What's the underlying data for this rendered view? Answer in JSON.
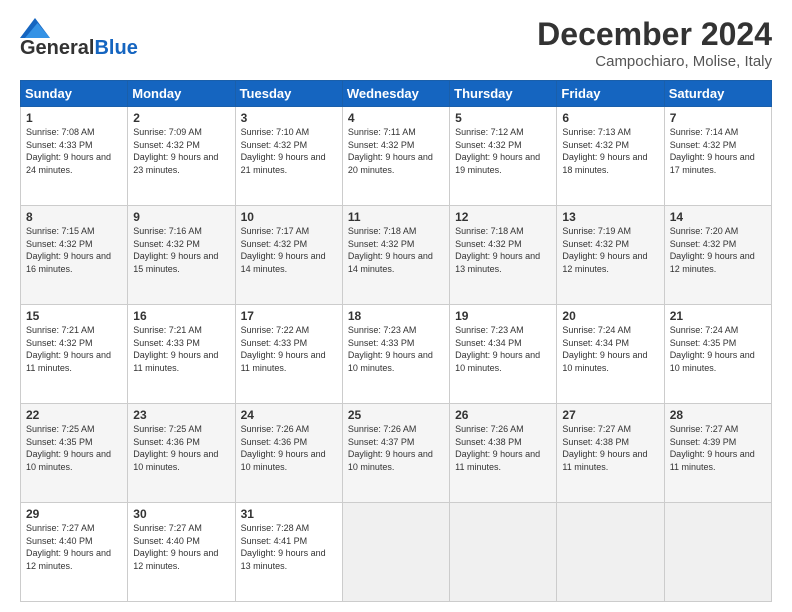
{
  "logo": {
    "general": "General",
    "blue": "Blue"
  },
  "title": "December 2024",
  "location": "Campochiaro, Molise, Italy",
  "days_of_week": [
    "Sunday",
    "Monday",
    "Tuesday",
    "Wednesday",
    "Thursday",
    "Friday",
    "Saturday"
  ],
  "weeks": [
    [
      {
        "day": "1",
        "sunrise": "Sunrise: 7:08 AM",
        "sunset": "Sunset: 4:33 PM",
        "daylight": "Daylight: 9 hours and 24 minutes."
      },
      {
        "day": "2",
        "sunrise": "Sunrise: 7:09 AM",
        "sunset": "Sunset: 4:32 PM",
        "daylight": "Daylight: 9 hours and 23 minutes."
      },
      {
        "day": "3",
        "sunrise": "Sunrise: 7:10 AM",
        "sunset": "Sunset: 4:32 PM",
        "daylight": "Daylight: 9 hours and 21 minutes."
      },
      {
        "day": "4",
        "sunrise": "Sunrise: 7:11 AM",
        "sunset": "Sunset: 4:32 PM",
        "daylight": "Daylight: 9 hours and 20 minutes."
      },
      {
        "day": "5",
        "sunrise": "Sunrise: 7:12 AM",
        "sunset": "Sunset: 4:32 PM",
        "daylight": "Daylight: 9 hours and 19 minutes."
      },
      {
        "day": "6",
        "sunrise": "Sunrise: 7:13 AM",
        "sunset": "Sunset: 4:32 PM",
        "daylight": "Daylight: 9 hours and 18 minutes."
      },
      {
        "day": "7",
        "sunrise": "Sunrise: 7:14 AM",
        "sunset": "Sunset: 4:32 PM",
        "daylight": "Daylight: 9 hours and 17 minutes."
      }
    ],
    [
      {
        "day": "8",
        "sunrise": "Sunrise: 7:15 AM",
        "sunset": "Sunset: 4:32 PM",
        "daylight": "Daylight: 9 hours and 16 minutes."
      },
      {
        "day": "9",
        "sunrise": "Sunrise: 7:16 AM",
        "sunset": "Sunset: 4:32 PM",
        "daylight": "Daylight: 9 hours and 15 minutes."
      },
      {
        "day": "10",
        "sunrise": "Sunrise: 7:17 AM",
        "sunset": "Sunset: 4:32 PM",
        "daylight": "Daylight: 9 hours and 14 minutes."
      },
      {
        "day": "11",
        "sunrise": "Sunrise: 7:18 AM",
        "sunset": "Sunset: 4:32 PM",
        "daylight": "Daylight: 9 hours and 14 minutes."
      },
      {
        "day": "12",
        "sunrise": "Sunrise: 7:18 AM",
        "sunset": "Sunset: 4:32 PM",
        "daylight": "Daylight: 9 hours and 13 minutes."
      },
      {
        "day": "13",
        "sunrise": "Sunrise: 7:19 AM",
        "sunset": "Sunset: 4:32 PM",
        "daylight": "Daylight: 9 hours and 12 minutes."
      },
      {
        "day": "14",
        "sunrise": "Sunrise: 7:20 AM",
        "sunset": "Sunset: 4:32 PM",
        "daylight": "Daylight: 9 hours and 12 minutes."
      }
    ],
    [
      {
        "day": "15",
        "sunrise": "Sunrise: 7:21 AM",
        "sunset": "Sunset: 4:32 PM",
        "daylight": "Daylight: 9 hours and 11 minutes."
      },
      {
        "day": "16",
        "sunrise": "Sunrise: 7:21 AM",
        "sunset": "Sunset: 4:33 PM",
        "daylight": "Daylight: 9 hours and 11 minutes."
      },
      {
        "day": "17",
        "sunrise": "Sunrise: 7:22 AM",
        "sunset": "Sunset: 4:33 PM",
        "daylight": "Daylight: 9 hours and 11 minutes."
      },
      {
        "day": "18",
        "sunrise": "Sunrise: 7:23 AM",
        "sunset": "Sunset: 4:33 PM",
        "daylight": "Daylight: 9 hours and 10 minutes."
      },
      {
        "day": "19",
        "sunrise": "Sunrise: 7:23 AM",
        "sunset": "Sunset: 4:34 PM",
        "daylight": "Daylight: 9 hours and 10 minutes."
      },
      {
        "day": "20",
        "sunrise": "Sunrise: 7:24 AM",
        "sunset": "Sunset: 4:34 PM",
        "daylight": "Daylight: 9 hours and 10 minutes."
      },
      {
        "day": "21",
        "sunrise": "Sunrise: 7:24 AM",
        "sunset": "Sunset: 4:35 PM",
        "daylight": "Daylight: 9 hours and 10 minutes."
      }
    ],
    [
      {
        "day": "22",
        "sunrise": "Sunrise: 7:25 AM",
        "sunset": "Sunset: 4:35 PM",
        "daylight": "Daylight: 9 hours and 10 minutes."
      },
      {
        "day": "23",
        "sunrise": "Sunrise: 7:25 AM",
        "sunset": "Sunset: 4:36 PM",
        "daylight": "Daylight: 9 hours and 10 minutes."
      },
      {
        "day": "24",
        "sunrise": "Sunrise: 7:26 AM",
        "sunset": "Sunset: 4:36 PM",
        "daylight": "Daylight: 9 hours and 10 minutes."
      },
      {
        "day": "25",
        "sunrise": "Sunrise: 7:26 AM",
        "sunset": "Sunset: 4:37 PM",
        "daylight": "Daylight: 9 hours and 10 minutes."
      },
      {
        "day": "26",
        "sunrise": "Sunrise: 7:26 AM",
        "sunset": "Sunset: 4:38 PM",
        "daylight": "Daylight: 9 hours and 11 minutes."
      },
      {
        "day": "27",
        "sunrise": "Sunrise: 7:27 AM",
        "sunset": "Sunset: 4:38 PM",
        "daylight": "Daylight: 9 hours and 11 minutes."
      },
      {
        "day": "28",
        "sunrise": "Sunrise: 7:27 AM",
        "sunset": "Sunset: 4:39 PM",
        "daylight": "Daylight: 9 hours and 11 minutes."
      }
    ],
    [
      {
        "day": "29",
        "sunrise": "Sunrise: 7:27 AM",
        "sunset": "Sunset: 4:40 PM",
        "daylight": "Daylight: 9 hours and 12 minutes."
      },
      {
        "day": "30",
        "sunrise": "Sunrise: 7:27 AM",
        "sunset": "Sunset: 4:40 PM",
        "daylight": "Daylight: 9 hours and 12 minutes."
      },
      {
        "day": "31",
        "sunrise": "Sunrise: 7:28 AM",
        "sunset": "Sunset: 4:41 PM",
        "daylight": "Daylight: 9 hours and 13 minutes."
      },
      null,
      null,
      null,
      null
    ]
  ]
}
